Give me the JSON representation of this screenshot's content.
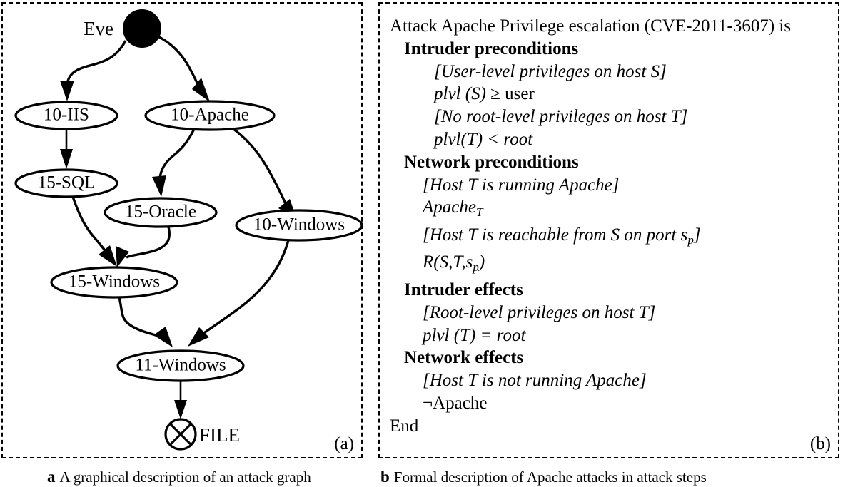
{
  "figure": {
    "panel_a": {
      "tag": "(a)",
      "caption_letter": "a",
      "caption_text": "A graphical description of an attack graph",
      "attacker_label": "Eve",
      "goal_label": "FILE",
      "nodes": [
        {
          "id": "iis10",
          "label": "10-IIS"
        },
        {
          "id": "apache10",
          "label": "10-Apache"
        },
        {
          "id": "sql15",
          "label": "15-SQL"
        },
        {
          "id": "oracle15",
          "label": "15-Oracle"
        },
        {
          "id": "windows10",
          "label": "10-Windows"
        },
        {
          "id": "windows15",
          "label": "15-Windows"
        },
        {
          "id": "windows11",
          "label": "11-Windows"
        }
      ],
      "edges": [
        {
          "from": "Eve",
          "to": "10-IIS"
        },
        {
          "from": "Eve",
          "to": "10-Apache"
        },
        {
          "from": "10-IIS",
          "to": "15-SQL"
        },
        {
          "from": "10-Apache",
          "to": "15-Oracle"
        },
        {
          "from": "10-Apache",
          "to": "10-Windows"
        },
        {
          "from": "15-SQL",
          "to": "15-Windows"
        },
        {
          "from": "15-Oracle",
          "to": "15-Windows"
        },
        {
          "from": "15-Windows",
          "to": "11-Windows"
        },
        {
          "from": "10-Windows",
          "to": "11-Windows"
        },
        {
          "from": "11-Windows",
          "to": "FILE"
        }
      ]
    },
    "panel_b": {
      "tag": "(b)",
      "caption_letter": "b",
      "caption_text": "Formal description of Apache attacks in attack steps",
      "lines": [
        {
          "indent": 0,
          "style": "plain",
          "text": "Attack Apache Privilege escalation (CVE-2011-3607) is"
        },
        {
          "indent": 1,
          "style": "bold",
          "text": "Intruder preconditions"
        },
        {
          "indent": 3,
          "style": "italic",
          "text": "[User-level privileges on host S]"
        },
        {
          "indent": 2,
          "style": "mixed",
          "text": "plvl (S) ≥ user"
        },
        {
          "indent": 2,
          "style": "italic",
          "text": "[No root-level privileges on host T]"
        },
        {
          "indent": 2,
          "style": "italic",
          "text": "plvl(T) < root"
        },
        {
          "indent": 1,
          "style": "bold",
          "text": "Network preconditions"
        },
        {
          "indent": 2,
          "style": "italic",
          "text": "[Host T is running Apache]"
        },
        {
          "indent": 2,
          "style": "italic",
          "text": "Apache_T"
        },
        {
          "indent": 2,
          "style": "italic",
          "text": "[Host T is reachable from S on port s_p]"
        },
        {
          "indent": 2,
          "style": "italic",
          "text": "R(S,T,s_p)"
        },
        {
          "indent": 1,
          "style": "bold",
          "text": "Intruder effects"
        },
        {
          "indent": 2,
          "style": "italic",
          "text": "[Root-level privileges on host T]"
        },
        {
          "indent": 2,
          "style": "italic",
          "text": "plvl (T) = root"
        },
        {
          "indent": 1,
          "style": "bold",
          "text": "Network effects"
        },
        {
          "indent": 2,
          "style": "italic",
          "text": "[Host T is not running Apache]"
        },
        {
          "indent": 2,
          "style": "plain",
          "text": "¬Apache"
        },
        {
          "indent": 0,
          "style": "plain",
          "text": "End"
        }
      ]
    }
  },
  "colors": {
    "ink": "#000000",
    "paper": "#ffffff"
  }
}
